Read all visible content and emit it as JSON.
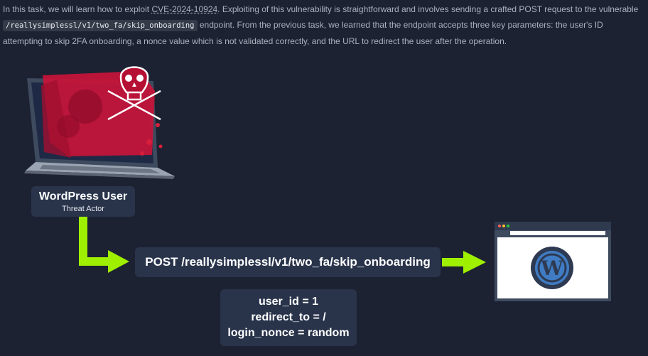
{
  "intro": {
    "part1": "In this task, we will learn how to exploit ",
    "cve": "CVE-2024-10924",
    "part2": ". Exploiting of this vulnerability is straightforward and involves sending a crafted POST request to the vulnerable ",
    "endpoint_code": "/reallysimplessl/v1/two_fa/skip_onboarding",
    "part3": " endpoint. From the previous task, we learned that the endpoint accepts three key parameters: the user's ID attempting to skip 2FA onboarding, a nonce value which is not validated correctly, and the URL to redirect the user after the operation."
  },
  "actor": {
    "title": "WordPress User",
    "subtitle": "Threat Actor"
  },
  "request": {
    "label": "POST /reallysimplessl/v1/two_fa/skip_onboarding"
  },
  "params": [
    "user_id = 1",
    "redirect_to = /",
    "login_nonce = random"
  ],
  "colors": {
    "arrow": "#9fef00",
    "box": "#29344b",
    "background": "#1c2232",
    "danger": "#d81e3c"
  },
  "icons": {
    "laptop": "laptop-skull-icon",
    "browser": "browser-wordpress-icon"
  }
}
